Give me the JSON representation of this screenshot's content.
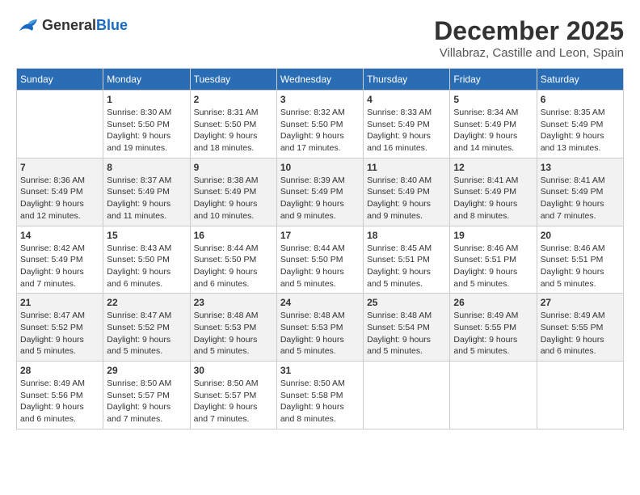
{
  "logo": {
    "general": "General",
    "blue": "Blue"
  },
  "title": "December 2025",
  "subtitle": "Villabraz, Castille and Leon, Spain",
  "days_of_week": [
    "Sunday",
    "Monday",
    "Tuesday",
    "Wednesday",
    "Thursday",
    "Friday",
    "Saturday"
  ],
  "weeks": [
    [
      {
        "day": "",
        "info": ""
      },
      {
        "day": "1",
        "info": "Sunrise: 8:30 AM\nSunset: 5:50 PM\nDaylight: 9 hours\nand 19 minutes."
      },
      {
        "day": "2",
        "info": "Sunrise: 8:31 AM\nSunset: 5:50 PM\nDaylight: 9 hours\nand 18 minutes."
      },
      {
        "day": "3",
        "info": "Sunrise: 8:32 AM\nSunset: 5:50 PM\nDaylight: 9 hours\nand 17 minutes."
      },
      {
        "day": "4",
        "info": "Sunrise: 8:33 AM\nSunset: 5:49 PM\nDaylight: 9 hours\nand 16 minutes."
      },
      {
        "day": "5",
        "info": "Sunrise: 8:34 AM\nSunset: 5:49 PM\nDaylight: 9 hours\nand 14 minutes."
      },
      {
        "day": "6",
        "info": "Sunrise: 8:35 AM\nSunset: 5:49 PM\nDaylight: 9 hours\nand 13 minutes."
      }
    ],
    [
      {
        "day": "7",
        "info": "Sunrise: 8:36 AM\nSunset: 5:49 PM\nDaylight: 9 hours\nand 12 minutes."
      },
      {
        "day": "8",
        "info": "Sunrise: 8:37 AM\nSunset: 5:49 PM\nDaylight: 9 hours\nand 11 minutes."
      },
      {
        "day": "9",
        "info": "Sunrise: 8:38 AM\nSunset: 5:49 PM\nDaylight: 9 hours\nand 10 minutes."
      },
      {
        "day": "10",
        "info": "Sunrise: 8:39 AM\nSunset: 5:49 PM\nDaylight: 9 hours\nand 9 minutes."
      },
      {
        "day": "11",
        "info": "Sunrise: 8:40 AM\nSunset: 5:49 PM\nDaylight: 9 hours\nand 9 minutes."
      },
      {
        "day": "12",
        "info": "Sunrise: 8:41 AM\nSunset: 5:49 PM\nDaylight: 9 hours\nand 8 minutes."
      },
      {
        "day": "13",
        "info": "Sunrise: 8:41 AM\nSunset: 5:49 PM\nDaylight: 9 hours\nand 7 minutes."
      }
    ],
    [
      {
        "day": "14",
        "info": "Sunrise: 8:42 AM\nSunset: 5:49 PM\nDaylight: 9 hours\nand 7 minutes."
      },
      {
        "day": "15",
        "info": "Sunrise: 8:43 AM\nSunset: 5:50 PM\nDaylight: 9 hours\nand 6 minutes."
      },
      {
        "day": "16",
        "info": "Sunrise: 8:44 AM\nSunset: 5:50 PM\nDaylight: 9 hours\nand 6 minutes."
      },
      {
        "day": "17",
        "info": "Sunrise: 8:44 AM\nSunset: 5:50 PM\nDaylight: 9 hours\nand 5 minutes."
      },
      {
        "day": "18",
        "info": "Sunrise: 8:45 AM\nSunset: 5:51 PM\nDaylight: 9 hours\nand 5 minutes."
      },
      {
        "day": "19",
        "info": "Sunrise: 8:46 AM\nSunset: 5:51 PM\nDaylight: 9 hours\nand 5 minutes."
      },
      {
        "day": "20",
        "info": "Sunrise: 8:46 AM\nSunset: 5:51 PM\nDaylight: 9 hours\nand 5 minutes."
      }
    ],
    [
      {
        "day": "21",
        "info": "Sunrise: 8:47 AM\nSunset: 5:52 PM\nDaylight: 9 hours\nand 5 minutes."
      },
      {
        "day": "22",
        "info": "Sunrise: 8:47 AM\nSunset: 5:52 PM\nDaylight: 9 hours\nand 5 minutes."
      },
      {
        "day": "23",
        "info": "Sunrise: 8:48 AM\nSunset: 5:53 PM\nDaylight: 9 hours\nand 5 minutes."
      },
      {
        "day": "24",
        "info": "Sunrise: 8:48 AM\nSunset: 5:53 PM\nDaylight: 9 hours\nand 5 minutes."
      },
      {
        "day": "25",
        "info": "Sunrise: 8:48 AM\nSunset: 5:54 PM\nDaylight: 9 hours\nand 5 minutes."
      },
      {
        "day": "26",
        "info": "Sunrise: 8:49 AM\nSunset: 5:55 PM\nDaylight: 9 hours\nand 5 minutes."
      },
      {
        "day": "27",
        "info": "Sunrise: 8:49 AM\nSunset: 5:55 PM\nDaylight: 9 hours\nand 6 minutes."
      }
    ],
    [
      {
        "day": "28",
        "info": "Sunrise: 8:49 AM\nSunset: 5:56 PM\nDaylight: 9 hours\nand 6 minutes."
      },
      {
        "day": "29",
        "info": "Sunrise: 8:50 AM\nSunset: 5:57 PM\nDaylight: 9 hours\nand 7 minutes."
      },
      {
        "day": "30",
        "info": "Sunrise: 8:50 AM\nSunset: 5:57 PM\nDaylight: 9 hours\nand 7 minutes."
      },
      {
        "day": "31",
        "info": "Sunrise: 8:50 AM\nSunset: 5:58 PM\nDaylight: 9 hours\nand 8 minutes."
      },
      {
        "day": "",
        "info": ""
      },
      {
        "day": "",
        "info": ""
      },
      {
        "day": "",
        "info": ""
      }
    ]
  ]
}
